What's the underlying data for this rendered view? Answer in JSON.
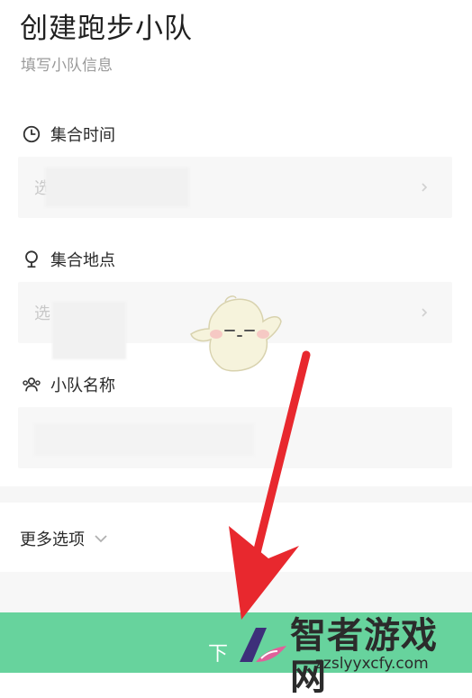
{
  "header": {
    "title": "创建跑步小队",
    "subtitle": "填写小队信息"
  },
  "form": {
    "meet_time": {
      "label": "集合时间",
      "icon": "clock-icon",
      "placeholder": "选"
    },
    "meet_place": {
      "label": "集合地点",
      "icon": "location-pin-icon",
      "placeholder": "选"
    },
    "team_name": {
      "label": "小队名称",
      "icon": "group-icon",
      "value": ""
    }
  },
  "more_options": {
    "label": "更多选项",
    "icon": "chevron-down-icon"
  },
  "footer": {
    "next_label": "下"
  },
  "watermark": {
    "title": "智者游戏网",
    "url": "zzslyyxcfy.com"
  },
  "colors": {
    "accent": "#67d39d",
    "annotation_arrow": "#e8282e",
    "field_background": "#f7f7f7",
    "placeholder": "#c8c8c8"
  }
}
